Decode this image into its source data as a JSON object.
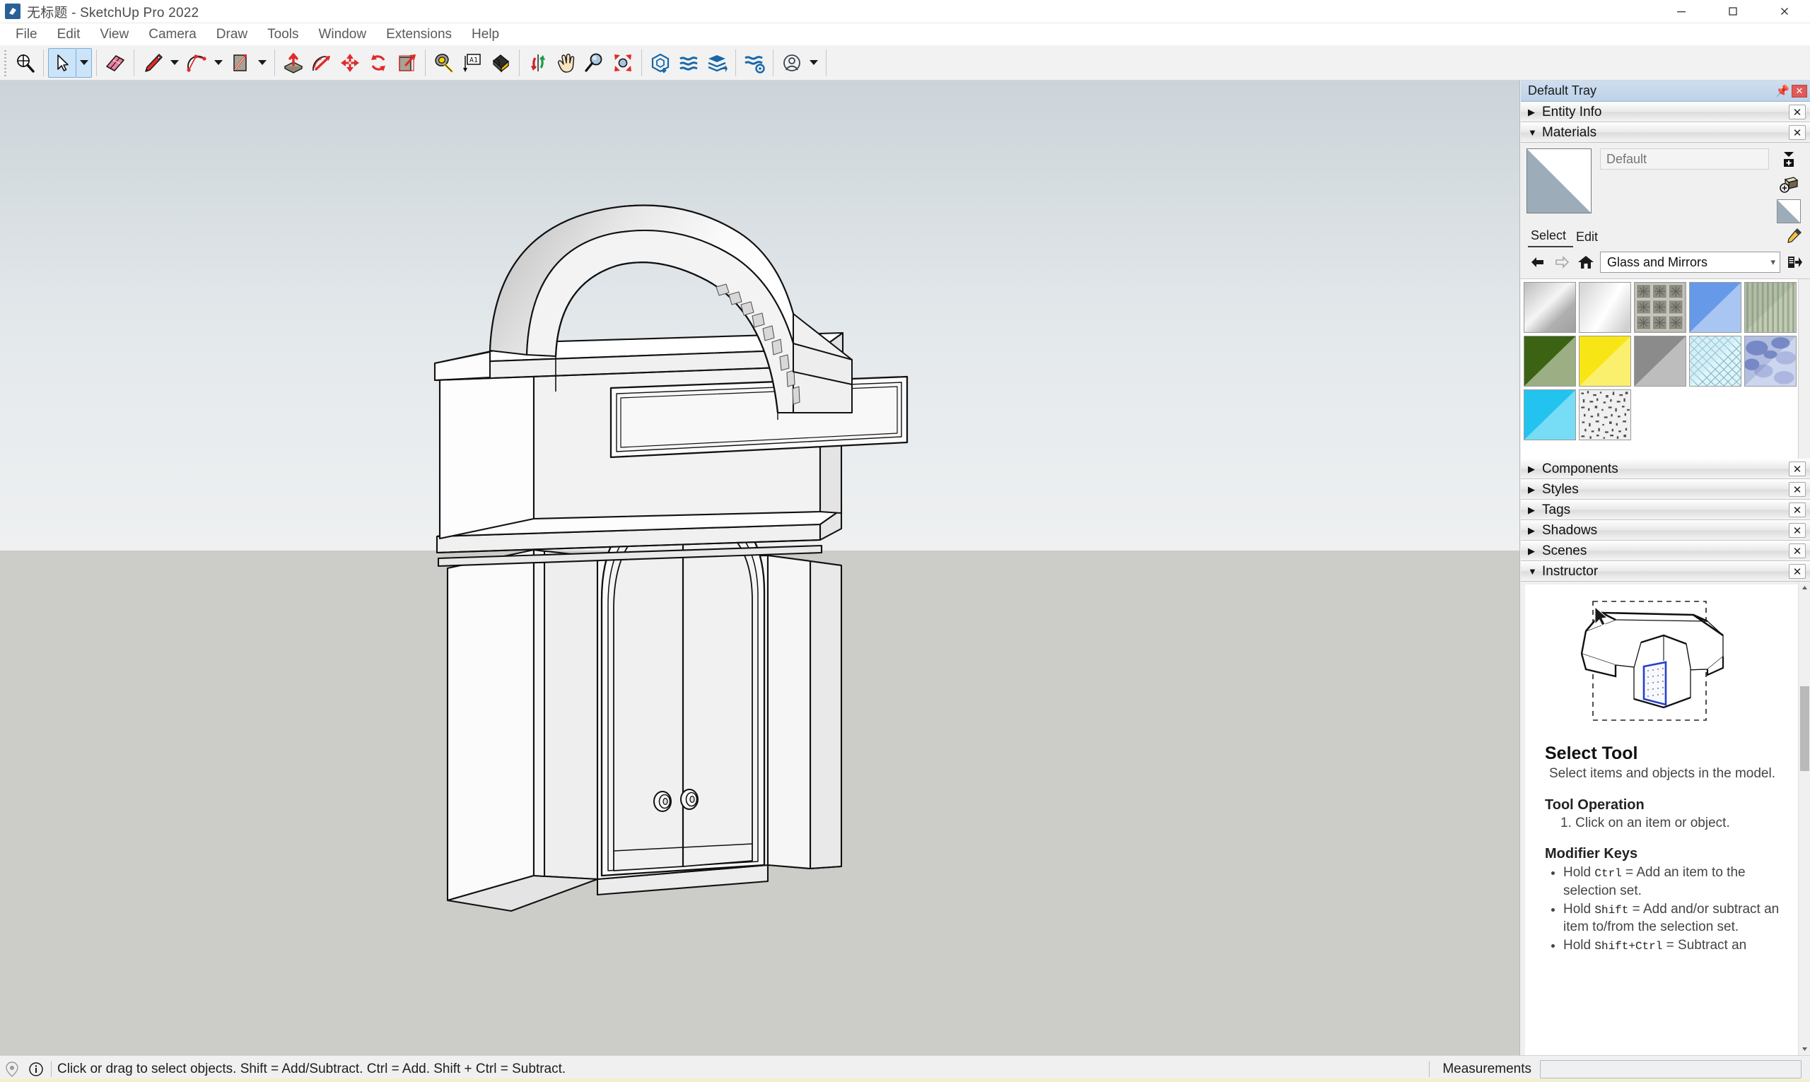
{
  "window": {
    "title": "无标题 - SketchUp Pro 2022",
    "logo_icon": "sketchup-logo-icon",
    "controls": [
      {
        "name": "minimize-button",
        "icon": "minimize-icon"
      },
      {
        "name": "maximize-button",
        "icon": "maximize-icon"
      },
      {
        "name": "close-button",
        "icon": "close-icon"
      }
    ]
  },
  "menubar": {
    "items": [
      {
        "label": "File"
      },
      {
        "label": "Edit"
      },
      {
        "label": "View"
      },
      {
        "label": "Camera"
      },
      {
        "label": "Draw"
      },
      {
        "label": "Tools"
      },
      {
        "label": "Window"
      },
      {
        "label": "Extensions"
      },
      {
        "label": "Help"
      }
    ]
  },
  "toolbar": {
    "tools": [
      {
        "name": "zoom-window-tool",
        "icon": "magnifier-crosshair-icon",
        "active": false,
        "dropdown": false
      },
      {
        "name": "select-tool",
        "icon": "arrow-cursor-icon",
        "active": true,
        "dropdown": true
      },
      {
        "name": "eraser-tool",
        "icon": "eraser-icon",
        "active": false,
        "dropdown": false
      },
      {
        "name": "line-tool",
        "icon": "pencil-icon",
        "active": false,
        "dropdown": true
      },
      {
        "name": "arc-tool",
        "icon": "arc-icon",
        "active": false,
        "dropdown": true
      },
      {
        "name": "rectangle-tool",
        "icon": "rectangle-icon",
        "active": false,
        "dropdown": true
      },
      {
        "name": "push-pull-tool",
        "icon": "push-pull-icon",
        "active": false,
        "dropdown": false
      },
      {
        "name": "follow-me-tool",
        "icon": "follow-me-icon",
        "active": false,
        "dropdown": false
      },
      {
        "name": "move-tool",
        "icon": "move-arrows-icon",
        "active": false,
        "dropdown": false
      },
      {
        "name": "rotate-tool",
        "icon": "rotate-icon",
        "active": false,
        "dropdown": false
      },
      {
        "name": "scale-tool",
        "icon": "scale-icon",
        "active": false,
        "dropdown": false
      },
      {
        "name": "tape-measure-tool",
        "icon": "tape-measure-icon",
        "active": false,
        "dropdown": false
      },
      {
        "name": "dimension-tool",
        "icon": "dimension-a1-icon",
        "active": false,
        "dropdown": false
      },
      {
        "name": "paint-bucket-tool",
        "icon": "paint-bucket-icon",
        "active": false,
        "dropdown": false
      },
      {
        "name": "orbit-tool",
        "icon": "orbit-icon",
        "active": false,
        "dropdown": false
      },
      {
        "name": "pan-tool",
        "icon": "hand-icon",
        "active": false,
        "dropdown": false
      },
      {
        "name": "zoom-tool",
        "icon": "magnifier-icon",
        "active": false,
        "dropdown": false
      },
      {
        "name": "zoom-extents-tool",
        "icon": "zoom-extents-icon",
        "active": false,
        "dropdown": false
      },
      {
        "name": "3d-warehouse-button",
        "icon": "warehouse-box-icon",
        "active": false,
        "dropdown": false
      },
      {
        "name": "extension-warehouse-button",
        "icon": "extension-warehouse-icon",
        "active": false,
        "dropdown": false
      },
      {
        "name": "share-model-button",
        "icon": "layers-share-icon",
        "active": false,
        "dropdown": false
      },
      {
        "name": "extension-manager-button",
        "icon": "extension-gear-icon",
        "active": false,
        "dropdown": false
      },
      {
        "name": "account-button",
        "icon": "user-avatar-icon",
        "active": false,
        "dropdown": true
      }
    ]
  },
  "viewport": {
    "sky_color": "#ccd4d9",
    "horizon_color": "#eef0f1",
    "ground_color": "#cccdc8",
    "model_name": "arched-entryway-facade",
    "model_description": "White arched entryway facade with barrel vault top, recessed sign panel, cornice bands and double doors with two round knobs"
  },
  "tray": {
    "title": "Default Tray",
    "pin_icon": "pin-icon",
    "close_icon": "close-icon",
    "panels": [
      {
        "name": "entity-info",
        "label": "Entity Info",
        "expanded": false
      },
      {
        "name": "materials",
        "label": "Materials",
        "expanded": true
      },
      {
        "name": "components",
        "label": "Components",
        "expanded": false
      },
      {
        "name": "styles",
        "label": "Styles",
        "expanded": false
      },
      {
        "name": "tags",
        "label": "Tags",
        "expanded": false
      },
      {
        "name": "shadows",
        "label": "Shadows",
        "expanded": false
      },
      {
        "name": "scenes",
        "label": "Scenes",
        "expanded": false
      },
      {
        "name": "instructor",
        "label": "Instructor",
        "expanded": true
      }
    ]
  },
  "materials": {
    "current_name": "Default",
    "name_placeholder": "Default",
    "swatch_icon": "default-material-swatch",
    "create_material_icon": "create-material-icon",
    "add-to-model_icon": "add-material-to-model-icon",
    "eyedropper_icon": "eyedropper-icon",
    "tabs": [
      {
        "name": "tab-select",
        "label": "Select",
        "active": true
      },
      {
        "name": "tab-edit",
        "label": "Edit",
        "active": false
      }
    ],
    "nav": {
      "back_icon": "back-arrow-icon",
      "forward_icon": "forward-arrow-icon",
      "home_icon": "home-icon",
      "details_icon": "details-arrow-icon"
    },
    "library": "Glass and Mirrors",
    "library_options": [
      "Glass and Mirrors"
    ],
    "swatches": [
      {
        "name": "mirror-silver",
        "kind": "gradient",
        "c1": "#c7c7c7",
        "c2": "#f2f2f2",
        "c3": "#a9a9a9"
      },
      {
        "name": "mirror-white",
        "kind": "gradient",
        "c1": "#e2e2e2",
        "c2": "#fefefe",
        "c3": "#d0d0d0"
      },
      {
        "name": "glass-block",
        "kind": "block",
        "c1": "#b6b6ad",
        "c2": "#8b8b82"
      },
      {
        "name": "glass-blue",
        "kind": "diag",
        "c1": "#6699e8",
        "c2": "#a9c5f2"
      },
      {
        "name": "glass-green-stripe",
        "kind": "stripe",
        "c1": "#9aa98d",
        "c2": "#c3cbb6"
      },
      {
        "name": "translucent-green",
        "kind": "diag",
        "c1": "#3b6313",
        "c2": "#9cae84"
      },
      {
        "name": "translucent-yellow",
        "kind": "diag",
        "c1": "#f7e516",
        "c2": "#fbf06e"
      },
      {
        "name": "translucent-gray",
        "kind": "diag",
        "c1": "#8b8b8b",
        "c2": "#bdbdbd"
      },
      {
        "name": "glass-safety-mesh",
        "kind": "mesh",
        "c1": "#d8f3fb",
        "c2": "#8fb8c4"
      },
      {
        "name": "glass-sky-reflection",
        "kind": "clouds",
        "c1": "#6b7dc4",
        "c2": "#cdd6ee"
      },
      {
        "name": "translucent-cyan",
        "kind": "diag",
        "c1": "#22c3ee",
        "c2": "#77dcf5"
      },
      {
        "name": "glass-frosted-noise",
        "kind": "noise",
        "c1": "#eeeeee",
        "c2": "#585858"
      }
    ]
  },
  "instructor": {
    "illustration_icon": "select-tool-illustration",
    "title": "Select Tool",
    "description": "Select items and objects in the model.",
    "operation_heading": "Tool Operation",
    "operation_steps": [
      "1. Click on an item or object."
    ],
    "modifier_heading": "Modifier Keys",
    "modifiers": [
      {
        "prefix": "Hold ",
        "key": "Ctrl",
        "suffix": " = Add an item to the selection set."
      },
      {
        "prefix": "Hold ",
        "key": "Shift",
        "suffix": " = Add and/or subtract an item to/from the selection set."
      },
      {
        "prefix": "Hold ",
        "key": "Shift+Ctrl",
        "suffix": " = Subtract an"
      }
    ]
  },
  "statusbar": {
    "geo_icon": "geo-location-icon",
    "info_icon": "info-circle-icon",
    "message": "Click or drag to select objects. Shift = Add/Subtract. Ctrl = Add. Shift + Ctrl = Subtract.",
    "measurements_label": "Measurements",
    "measurements_value": ""
  }
}
